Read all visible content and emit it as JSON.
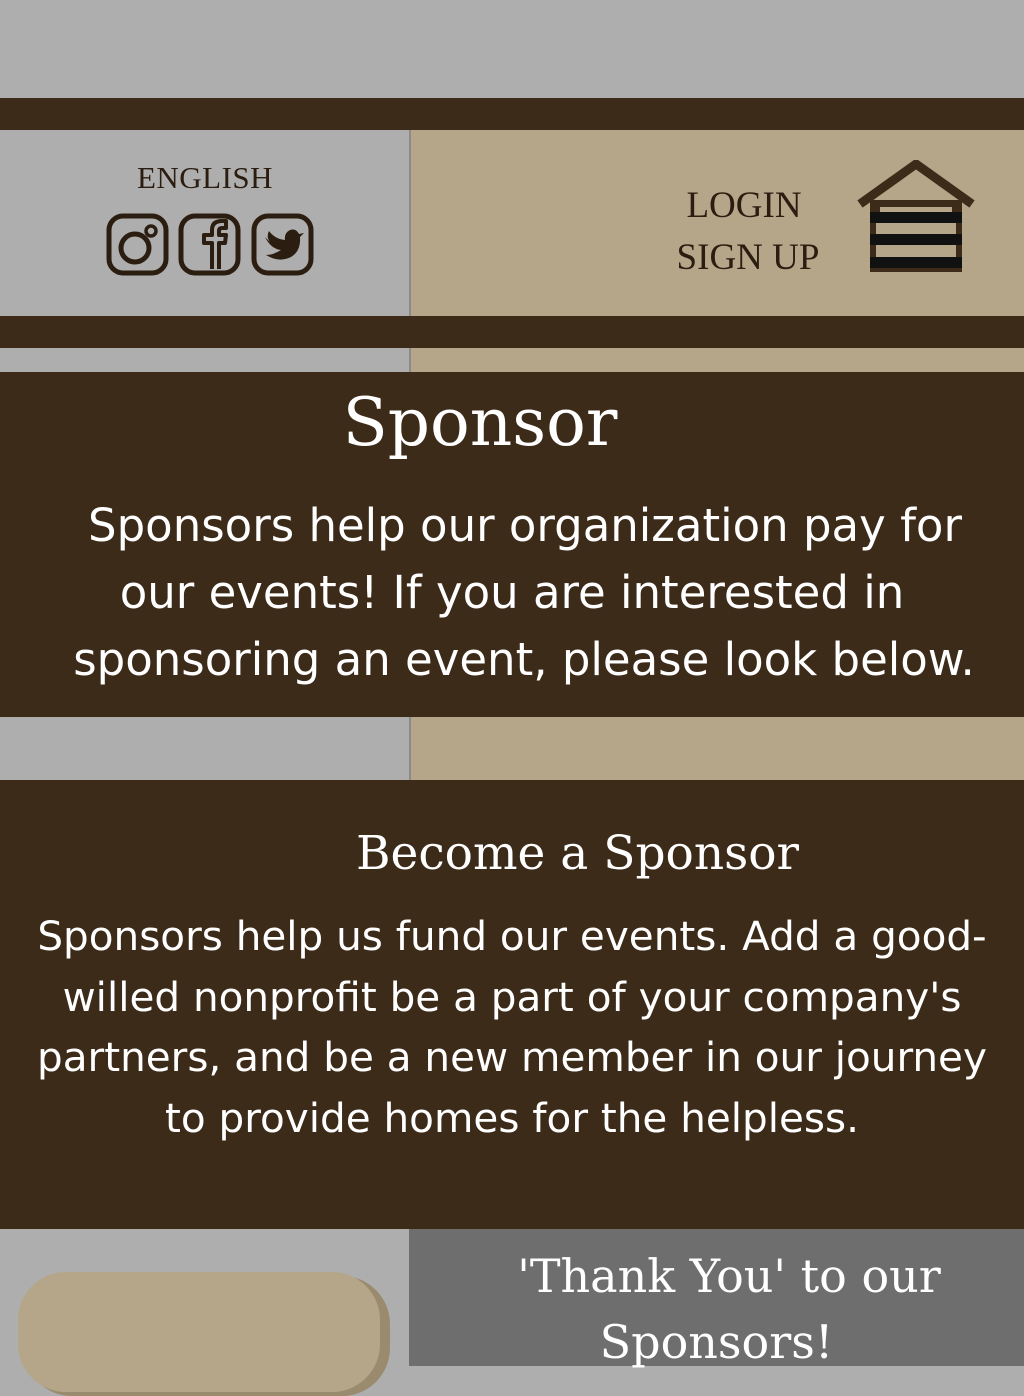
{
  "header": {
    "language": "ENGLISH",
    "login": "LOGIN",
    "signup": "SIGN UP",
    "social_icons": [
      "instagram-icon",
      "facebook-icon",
      "twitter-icon"
    ],
    "menu_icon": "home-menu-icon"
  },
  "sponsor_section": {
    "title": "Sponsor",
    "description_lines": [
      "Sponsors help our organization pay for",
      "our events! If you are interested in",
      "sponsoring an event, please look below."
    ]
  },
  "become_section": {
    "title": "Become a Sponsor",
    "description_lines": [
      "Sponsors help us fund our events. Add a good-",
      "willed nonprofit be a part of your company's",
      "partners, and be a new member in our journey",
      "to provide homes for the helpless."
    ]
  },
  "thanks_section": {
    "title_line1": "'Thank You' to our",
    "title_line2": "Sponsors!"
  },
  "colors": {
    "dark_brown": "#3d2b1a",
    "tan": "#b5a68a",
    "gray": "#aeaeae",
    "mid_gray": "#6e6e6e"
  }
}
